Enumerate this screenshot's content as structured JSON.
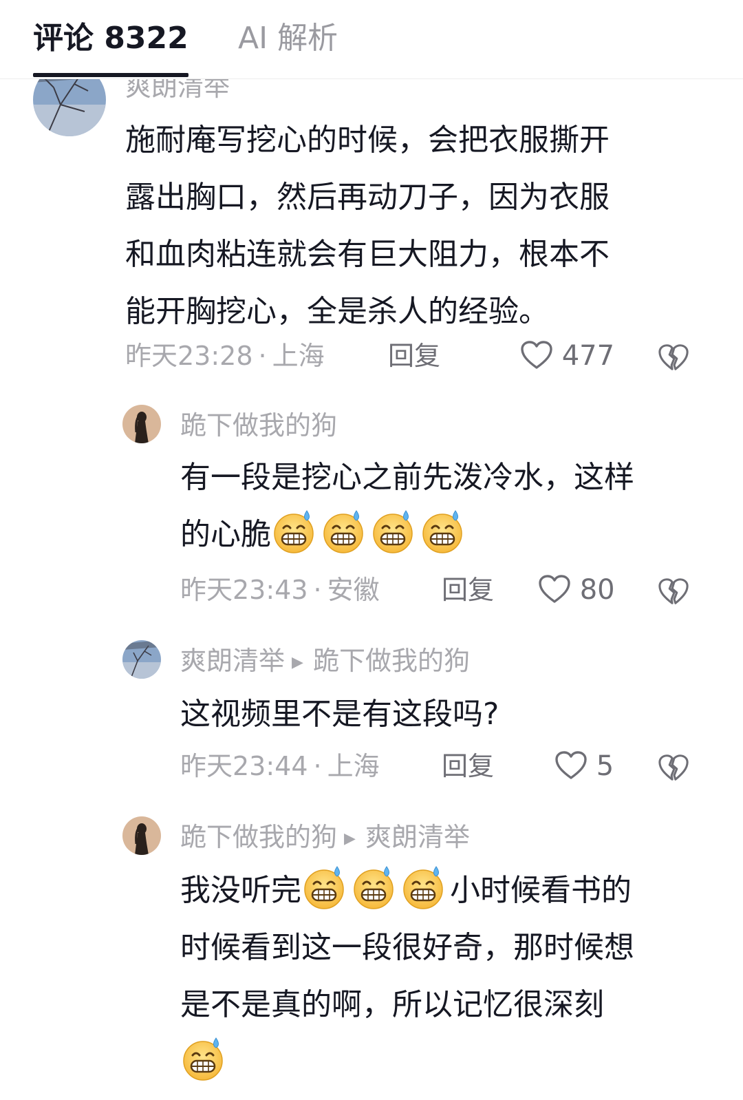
{
  "tabs": {
    "comments_label": "评论 8322",
    "ai_label": "AI 解析"
  },
  "comments": [
    {
      "username": "爽朗清举",
      "lines": [
        "施耐庵写挖心的时候，会把衣服撕开",
        "露出胸口，然后再动刀子，因为衣服",
        "和血肉粘连就会有巨大阻力，根本不",
        "能开胸挖心，全是杀人的经验。"
      ],
      "time": "昨天23:28",
      "location": "上海",
      "reply_label": "回复",
      "likes": "477"
    },
    {
      "username": "跪下做我的狗",
      "lines": [
        "有一段是挖心之前先泼冷水，这样",
        "的心脆"
      ],
      "time": "昨天23:43",
      "location": "安徽",
      "reply_label": "回复",
      "likes": "80"
    },
    {
      "username": "爽朗清举",
      "reply_to": "跪下做我的狗",
      "lines": [
        "这视频里不是有这段吗?"
      ],
      "time": "昨天23:44",
      "location": "上海",
      "reply_label": "回复",
      "likes": "5"
    },
    {
      "username": "跪下做我的狗",
      "reply_to": "爽朗清举",
      "lines": [
        "我没听完",
        "小时候看书的",
        "时候看到这一段很好奇，那时候想",
        "是不是真的啊，所以记忆很深刻"
      ]
    }
  ],
  "colors": {
    "text": "#161823",
    "secondary": "#a8a8ad",
    "action": "#6e6e75",
    "tab_indicator": "#161823"
  },
  "icons": [
    "heart-outline-icon",
    "dislike-broken-heart-icon",
    "grinning-sweat-emoji"
  ]
}
